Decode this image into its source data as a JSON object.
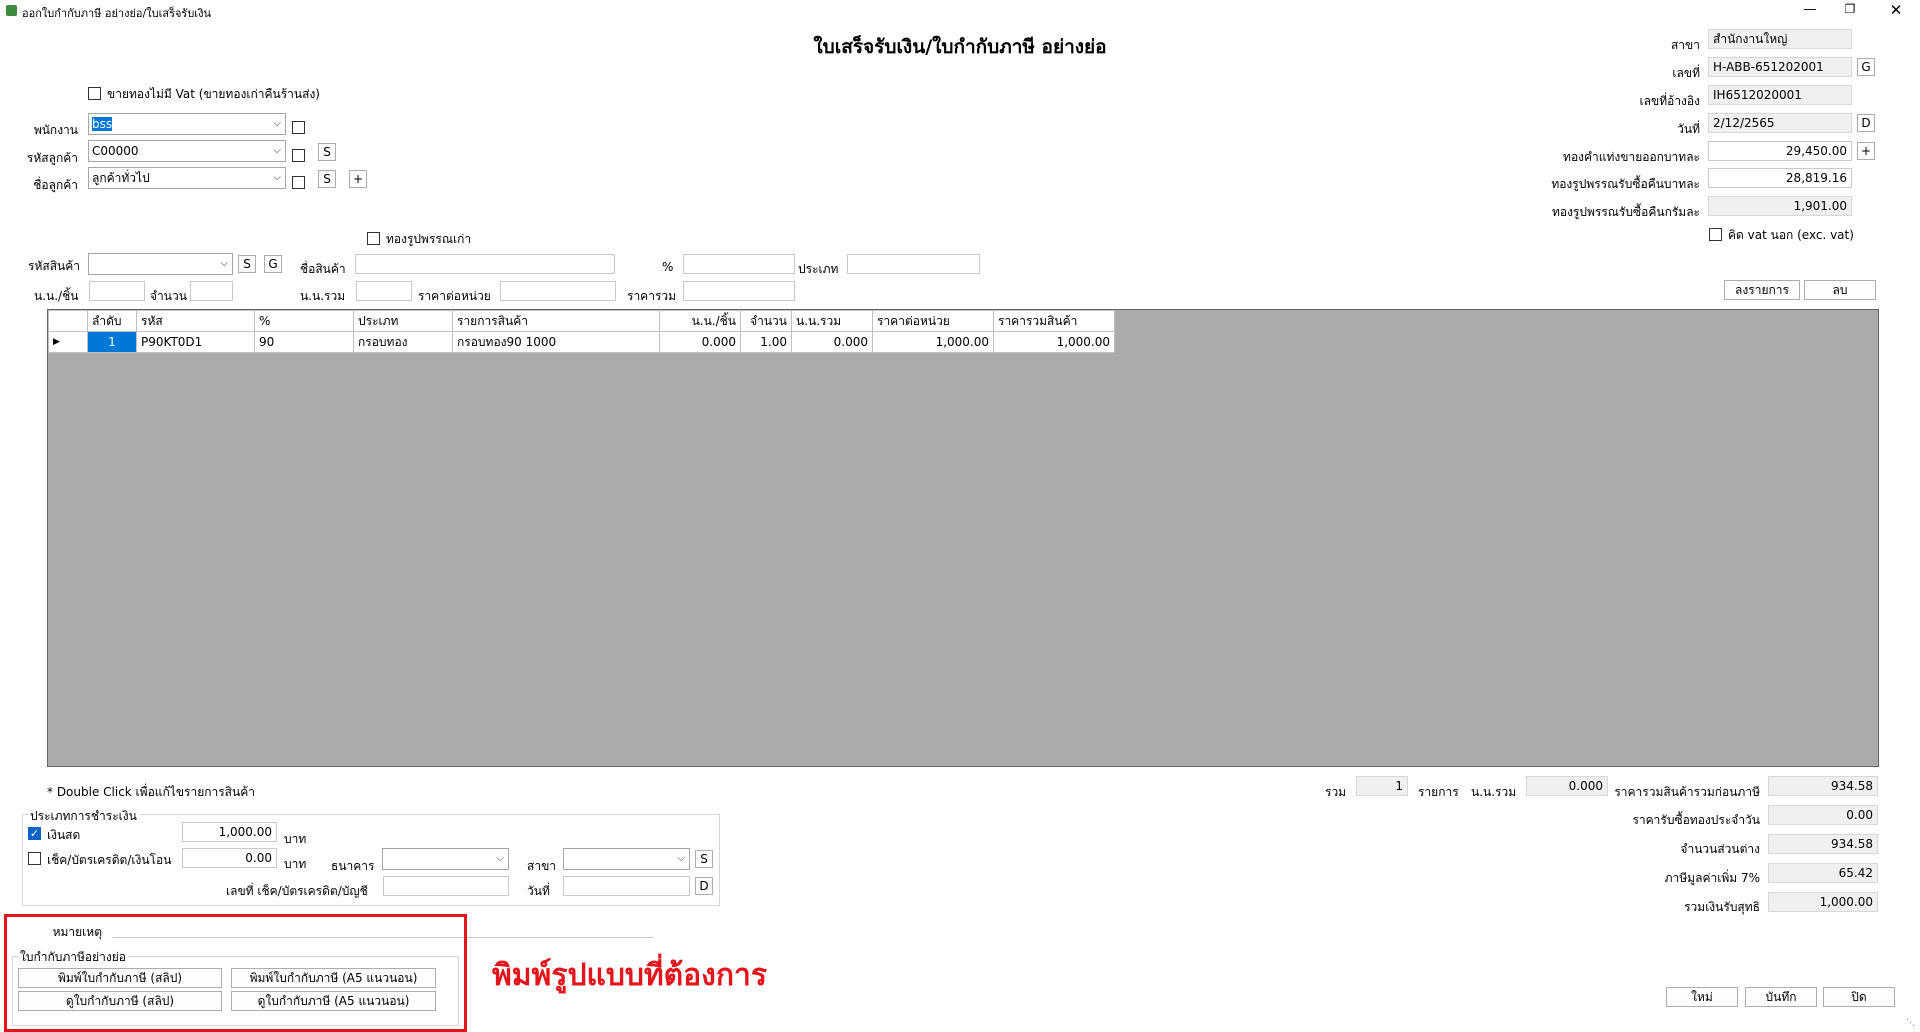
{
  "window": {
    "title": "ออกใบกำกับภาษี อย่างย่อ/ใบเสร็จรับเงิน",
    "heading": "ใบเสร็จรับเงิน/ใบกำกับภาษี อย่างย่อ"
  },
  "header_right": {
    "branch_label": "สาขา",
    "branch_value": "สำนักงานใหญ่",
    "doc_no_label": "เลขที่",
    "doc_no_value": "H-ABB-651202001",
    "doc_no_btn": "G",
    "ref_label": "เลขที่อ้างอิง",
    "ref_value": "IH6512020001",
    "date_label": "วันที่",
    "date_value": "2/12/2565",
    "date_btn": "D",
    "gold_sell_label": "ทองคำแท่งขายออกบาทละ",
    "gold_sell_value": "29,450.00",
    "gold_sell_btn": "+",
    "gold_buy_baht_label": "ทองรูปพรรณรับซื้อคืนบาทละ",
    "gold_buy_baht_value": "28,819.16",
    "gold_buy_gram_label": "ทองรูปพรรณรับซื้อคืนกรัมละ",
    "gold_buy_gram_value": "1,901.00",
    "excl_vat_label": "คิด vat นอก (exc. vat)"
  },
  "customer": {
    "no_vat_label": "ขายทองไม่มี Vat (ขายทองเก่าคืนร้านส่ง)",
    "employee_label": "พนักงาน",
    "employee_value": "bss",
    "customer_code_label": "รหัสลูกค้า",
    "customer_code_value": "C00000",
    "customer_code_btn": "S",
    "customer_name_label": "ชื่อลูกค้า",
    "customer_name_value": "ลูกค้าทั่วไป",
    "customer_name_btn": "S",
    "customer_name_add": "+"
  },
  "product": {
    "old_gold_label": "ทองรูปพรรณเก่า",
    "code_label": "รหัสสินค้า",
    "code_btn_s": "S",
    "code_btn_g": "G",
    "name_label": "ชื่อสินค้า",
    "percent_label": "%",
    "type_label": "ประเภท",
    "weight_piece_label": "น.น./ชิ้น",
    "qty_label": "จำนวน",
    "weight_total_label": "น.น.รวม",
    "unit_price_label": "ราคาต่อหน่วย",
    "total_price_label": "ราคารวม",
    "add_button": "ลงรายการ",
    "delete_button": "ลบ"
  },
  "grid": {
    "columns": [
      "ลำดับ",
      "รหัส",
      "%",
      "ประเภท",
      "รายการสินค้า",
      "น.น./ชิ้น",
      "จำนวน",
      "น.น.รวม",
      "ราคาต่อหน่วย",
      "ราคารวมสินค้า"
    ],
    "rows": [
      [
        "1",
        "P90KT0D1",
        "90",
        "กรอบทอง",
        "กรอบทอง90 1000",
        "0.000",
        "1.00",
        "0.000",
        "1,000.00",
        "1,000.00"
      ]
    ],
    "hint": "* Double Click เพื่อแก้ไขรายการสินค้า"
  },
  "totals_row": {
    "sum_label": "รวม",
    "sum_value": "1",
    "items_label": "รายการ",
    "weight_label": "น.น.รวม",
    "weight_value": "0.000"
  },
  "summary": {
    "before_vat_label": "ราคารวมสินค้ารวมก่อนภาษี",
    "before_vat_value": "934.58",
    "buyback_label": "ราคารับซื้อทองประจำวัน",
    "buyback_value": "0.00",
    "diff_label": "จำนวนส่วนต่าง",
    "diff_value": "934.58",
    "vat_label": "ภาษีมูลค่าเพิ่ม 7%",
    "vat_value": "65.42",
    "net_label": "รวมเงินรับสุทธิ",
    "net_value": "1,000.00"
  },
  "payment": {
    "group_label": "ประเภทการชำระเงิน",
    "cash_label": "เงินสด",
    "cash_value": "1,000.00",
    "cash_unit": "บาท",
    "cheque_label": "เช็ค/บัตรเครดิต/เงินโอน",
    "cheque_value": "0.00",
    "cheque_unit": "บาท",
    "bank_label": "ธนาคาร",
    "branch_label": "สาขา",
    "branch_btn": "S",
    "account_label": "เลขที่ เช็ค/บัตรเครดิต/บัญชี",
    "date_label": "วันที่",
    "date_btn": "D"
  },
  "remark": {
    "label": "หมายเหตุ"
  },
  "print_group": {
    "label": "ใบกำกับภาษีอย่างย่อ",
    "print_slip": "พิมพ์ใบกำกับภาษี (สลิป)",
    "print_a5": "พิมพ์ใบกำกับภาษี (A5 แนวนอน)",
    "view_slip": "ดูใบกำกับภาษี (สลิป)",
    "view_a5": "ดูใบกำกับภาษี (A5 แนวนอน)"
  },
  "annotation": {
    "text": "พิมพ์รูปแบบที่ต้องการ",
    "color": "#e3141b"
  },
  "footer": {
    "new_button": "ใหม่",
    "save_button": "บันทึก",
    "close_button": "ปิด"
  }
}
